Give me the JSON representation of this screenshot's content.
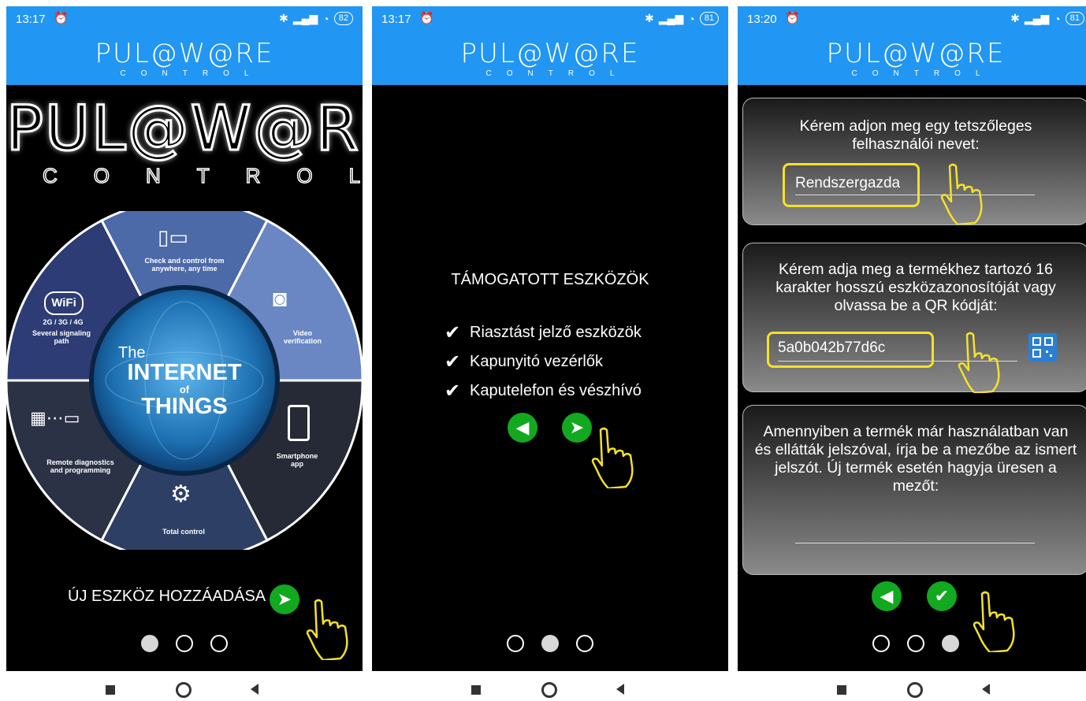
{
  "status": [
    {
      "time": "13:17",
      "battery": "82"
    },
    {
      "time": "13:17",
      "battery": "81"
    },
    {
      "time": "13:20",
      "battery": "81"
    }
  ],
  "header": {
    "logo_main": "PUL@W@RE",
    "logo_sub": "CONTROL"
  },
  "screen1": {
    "logo_main": "PUL@W@RE",
    "logo_sub": "CONTROL",
    "wheel": {
      "center_the": "The",
      "center_internet": "INTERNET",
      "center_of": "of",
      "center_things": "THINGS",
      "seg_top": "Check and control from anywhere, any time",
      "seg_right_top": "Video verification",
      "seg_right_bottom": "Smartphone app",
      "seg_bottom": "Total control",
      "seg_left_bottom": "Remote diagnostics and programming",
      "seg_left_top_speeds": "2G / 3G / 4G",
      "seg_left_top": "Several signaling path",
      "wifi": "WiFi"
    },
    "add_label": "ÚJ ESZKÖZ HOZZÁADÁSA",
    "active_page": 0
  },
  "screen2": {
    "title": "TÁMOGATOTT ESZKÖZÖK",
    "items": [
      "Riasztást jelző eszközök",
      "Kapunyitó vezérlők",
      "Kaputelefon és vészhívó"
    ],
    "active_page": 1
  },
  "screen3": {
    "username_prompt": "Kérem adjon meg egy tetszőleges felhasználói nevet:",
    "username_value": "Rendszergazda",
    "device_prompt": "Kérem adja meg a termékhez tartozó 16 karakter hosszú eszközazonosítóját vagy olvassa be a QR kódját:",
    "device_value": "5a0b042b77d6c",
    "password_prompt": "Amennyiben a termék már használatban van és ellátták jelszóval, írja be a mezőbe az ismert jelszót. Új termék esetén hagyja üresen a mezőt:",
    "password_value": "",
    "active_page": 2
  },
  "colors": {
    "header_blue": "#2196f3",
    "button_green": "#12a81f",
    "highlight_yellow": "#f4e12c"
  }
}
